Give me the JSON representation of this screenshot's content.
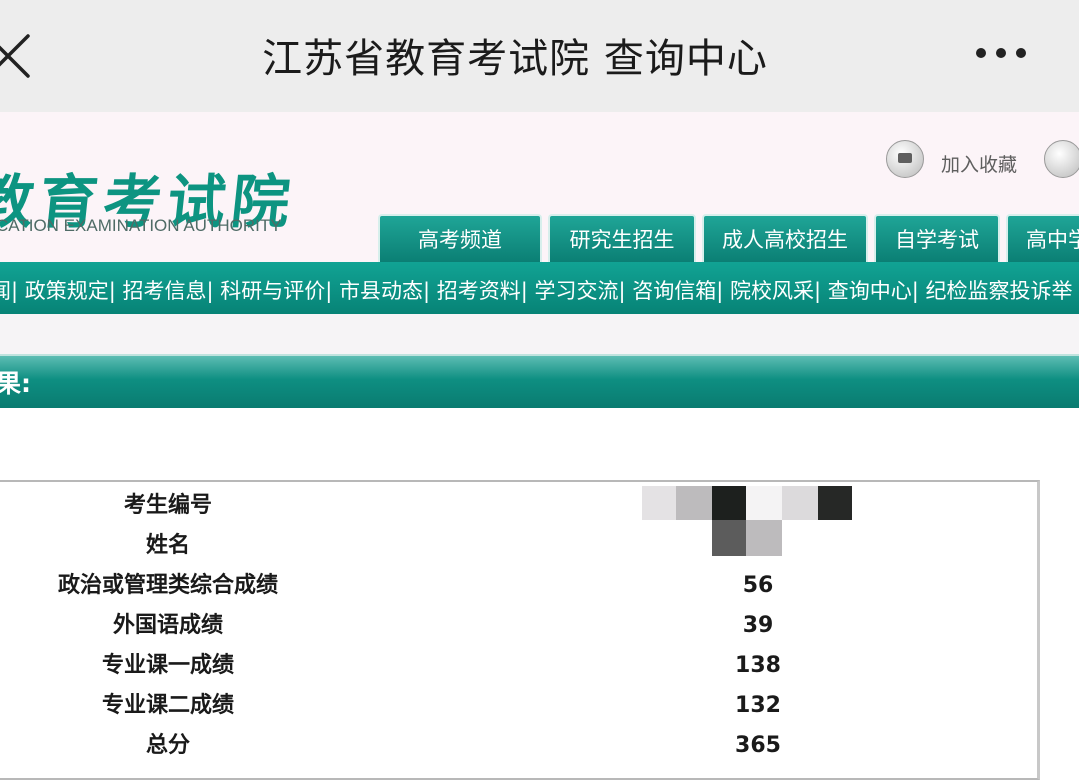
{
  "appbar": {
    "title": "江苏省教育考试院 查询中心"
  },
  "header": {
    "logo_cn": "教育考试院",
    "logo_en": "CATION EXAMINATION AUTHORITY",
    "favorite_label": "加入收藏"
  },
  "tabs": [
    {
      "label": "高考频道"
    },
    {
      "label": "研究生招生"
    },
    {
      "label": "成人高校招生"
    },
    {
      "label": "自学考试"
    },
    {
      "label": "高中学"
    }
  ],
  "subnav": {
    "text": "闻| 政策规定| 招考信息| 科研与评价| 市县动态| 招考资料| 学习交流| 咨询信箱| 院校风采| 查询中心| 纪检监察投诉举"
  },
  "result": {
    "heading": "果:",
    "rows": [
      {
        "label": "考生编号",
        "value": ""
      },
      {
        "label": "姓名",
        "value": ""
      },
      {
        "label": "政治或管理类综合成绩",
        "value": "56"
      },
      {
        "label": "外国语成绩",
        "value": "39"
      },
      {
        "label": "专业课一成绩",
        "value": "138"
      },
      {
        "label": "专业课二成绩",
        "value": "132"
      },
      {
        "label": "总分",
        "value": "365"
      }
    ]
  },
  "colors": {
    "brand_teal": "#0e8f82",
    "logo_green": "#0d9481",
    "appbar_bg": "#ededed"
  }
}
